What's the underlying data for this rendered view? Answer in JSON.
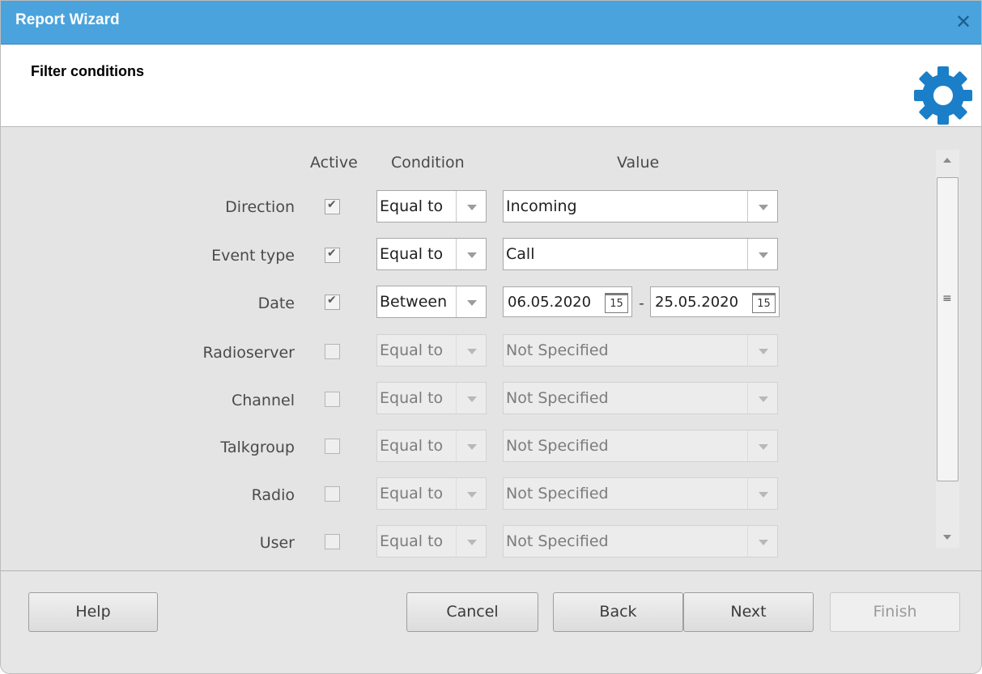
{
  "window": {
    "title": "Report Wizard",
    "close_glyph": "✕"
  },
  "header": {
    "subtitle": "Filter conditions",
    "icon": "gear-icon"
  },
  "columns": {
    "active": "Active",
    "condition": "Condition",
    "value": "Value"
  },
  "rows": [
    {
      "label": "Direction",
      "active": true,
      "condition": "Equal to",
      "value": "Incoming",
      "enabled": true
    },
    {
      "label": "Event type",
      "active": true,
      "condition": "Equal to",
      "value": "Call",
      "enabled": true
    },
    {
      "label": "Date",
      "active": true,
      "condition": "Between",
      "date_from": "06.05.2020",
      "date_to": "25.05.2020",
      "calendar_glyph": "15",
      "separator": "-",
      "enabled": true
    },
    {
      "label": "Radioserver",
      "active": false,
      "condition": "Equal to",
      "value": "Not Specified",
      "enabled": false
    },
    {
      "label": "Channel",
      "active": false,
      "condition": "Equal to",
      "value": "Not Specified",
      "enabled": false
    },
    {
      "label": "Talkgroup",
      "active": false,
      "condition": "Equal to",
      "value": "Not Specified",
      "enabled": false
    },
    {
      "label": "Radio",
      "active": false,
      "condition": "Equal to",
      "value": "Not Specified",
      "enabled": false
    },
    {
      "label": "User",
      "active": false,
      "condition": "Equal to",
      "value": "Not Specified",
      "enabled": false
    }
  ],
  "scrollbar": {
    "grip_glyph": "≡"
  },
  "buttons": {
    "help": "Help",
    "cancel": "Cancel",
    "back": "Back",
    "next": "Next",
    "finish": "Finish"
  },
  "colors": {
    "titlebar": "#4aa3dc",
    "gear": "#1a7fc8",
    "close": "#1b5e8f"
  }
}
